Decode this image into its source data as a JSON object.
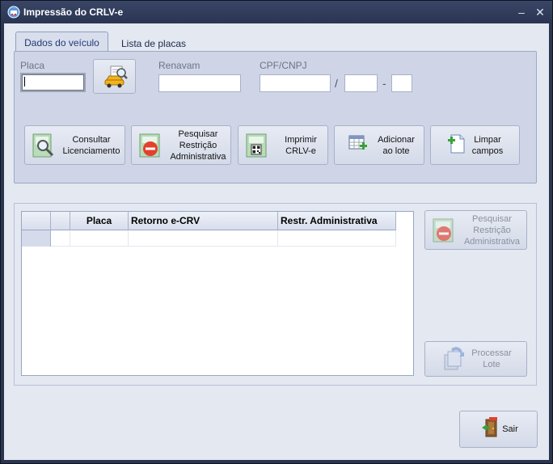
{
  "window": {
    "title": "Impressão do CRLV-e",
    "minimize_glyph": "–",
    "close_glyph": "✕"
  },
  "tabs": [
    {
      "label": "Dados do veículo",
      "active": true
    },
    {
      "label": "Lista de placas",
      "active": false
    }
  ],
  "form": {
    "placa_label": "Placa",
    "placa_value": "",
    "renavam_label": "Renavam",
    "renavam_value": "",
    "cpf_label": "CPF/CNPJ",
    "cpf_value": "",
    "cpf_branch_value": "",
    "cpf_digit_value": "",
    "slash": "/",
    "dash": "-"
  },
  "actions": [
    {
      "label": "Consultar\nLicenciamento",
      "icon": "search-document-icon"
    },
    {
      "label": "Pesquisar\nRestrição\nAdministrativa",
      "icon": "restriction-icon"
    },
    {
      "label": "Imprimir\nCRLV-e",
      "icon": "qr-document-icon"
    },
    {
      "label": "Adicionar\nao lote",
      "icon": "add-table-icon"
    },
    {
      "label": "Limpar\ncampos",
      "icon": "new-document-icon"
    }
  ],
  "grid": {
    "columns": [
      "",
      "",
      "Placa",
      "Retorno e-CRV",
      "Restr. Administrativa"
    ],
    "rows": [
      [
        "",
        "",
        "",
        "",
        ""
      ]
    ]
  },
  "side_actions": {
    "restriction_label": "Pesquisar\nRestrição\nAdministrativa",
    "process_label": "Processar\nLote",
    "enabled": false
  },
  "exit_label": "Sair",
  "colors": {
    "accent_red": "#e2412c",
    "accent_green": "#3aa13a",
    "title_bar": "#2f3a57"
  }
}
